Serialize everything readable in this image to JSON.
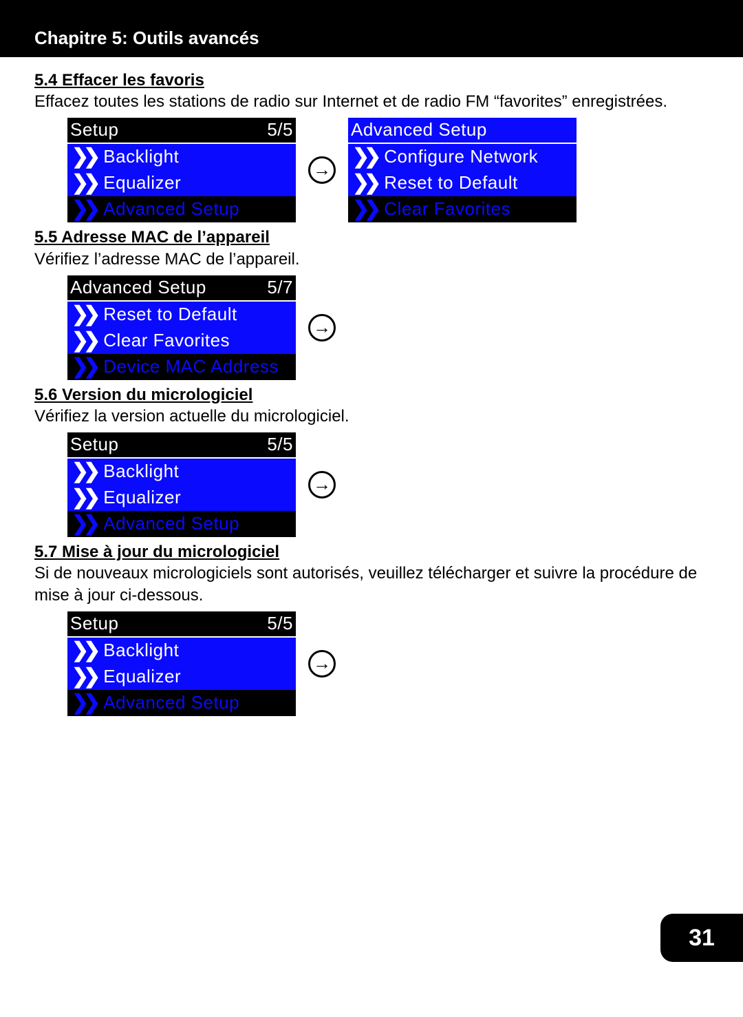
{
  "header": {
    "title": "Chapitre 5: Outils avancés"
  },
  "sections": {
    "s54": {
      "title": "5.4 Effacer les favoris",
      "body": "Effacez toutes les stations de radio sur Internet et de radio FM “favorites” enregistrées."
    },
    "s55": {
      "title": "5.5 Adresse MAC de l’appareil",
      "body": "Vérifiez l’adresse MAC de l’appareil."
    },
    "s56": {
      "title": "5.6 Version du micrologiciel",
      "body": "Vérifiez la version actuelle du micrologiciel."
    },
    "s57": {
      "title": "5.7 Mise à jour du micrologiciel",
      "body": "Si de nouveaux micrologiciels sont autorisés, veuillez télécharger et suivre la procédure de mise à jour ci-dessous."
    }
  },
  "screens": {
    "setup55": {
      "title": "Setup",
      "counter": "5/5",
      "items": [
        "Backlight",
        "Equalizer",
        "Advanced Setup"
      ],
      "selectedIndex": 2
    },
    "advSetup": {
      "titleInv": "Advanced Setup",
      "items": [
        "Configure Network",
        "Reset to Default",
        "Clear Favorites"
      ],
      "selectedIndex": 2
    },
    "advSetup57": {
      "title": "Advanced Setup",
      "counter": "5/7",
      "items": [
        "Reset to Default",
        "Clear Favorites",
        "Device MAC Address"
      ],
      "selectedIndex": 2
    }
  },
  "glyphs": {
    "chev": "❯❯",
    "arrow": "→"
  },
  "pageNumber": "31"
}
